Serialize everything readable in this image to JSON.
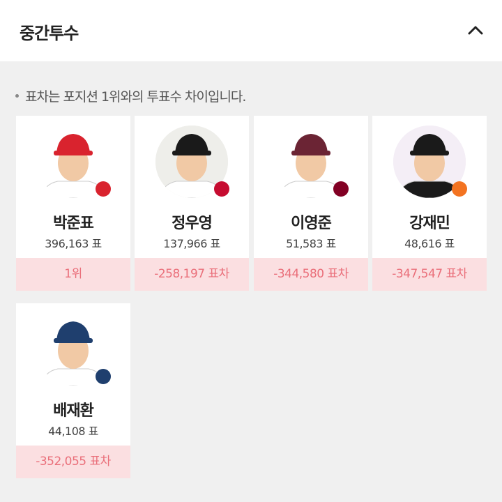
{
  "header": {
    "title": "중간투수",
    "collapse_icon": "chevron-up-icon"
  },
  "note": "표차는 포지션 1위와의 투표수 차이입니다.",
  "players": [
    {
      "name": "박준표",
      "votes": "396,163 표",
      "diff": "1위",
      "cap_color": "#d9232e",
      "jersey_color": "#ffffff",
      "logo_color": "#d9232e"
    },
    {
      "name": "정우영",
      "votes": "137,966 표",
      "diff": "-258,197 표차",
      "cap_color": "#1a1a1a",
      "jersey_color": "#ffffff",
      "logo_color": "#c60c30"
    },
    {
      "name": "이영준",
      "votes": "51,583 표",
      "diff": "-344,580 표차",
      "cap_color": "#6b2434",
      "jersey_color": "#ffffff",
      "logo_color": "#820024"
    },
    {
      "name": "강재민",
      "votes": "48,616 표",
      "diff": "-347,547 표차",
      "cap_color": "#1a1a1a",
      "jersey_color": "#1a1a1a",
      "logo_color": "#f37321"
    },
    {
      "name": "배재환",
      "votes": "44,108 표",
      "diff": "-352,055 표차",
      "cap_color": "#1f3f6e",
      "jersey_color": "#ffffff",
      "logo_color": "#1f3f6e"
    }
  ],
  "colors": {
    "accent_text": "#ea6f7a",
    "accent_bg": "#fbdfe1",
    "page_bg": "#f0f0f0"
  }
}
